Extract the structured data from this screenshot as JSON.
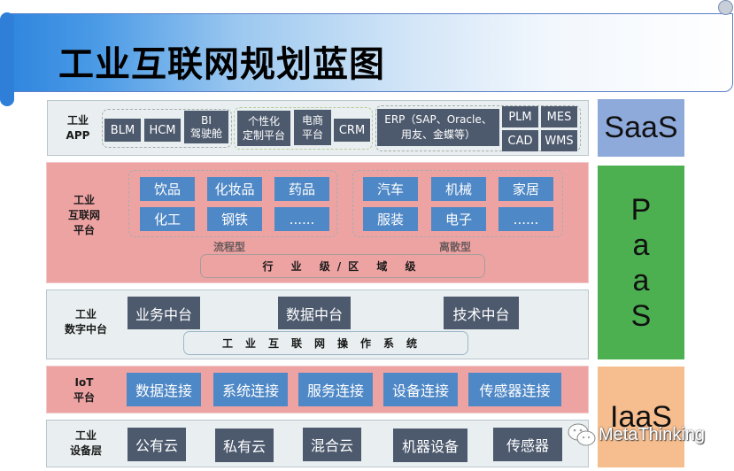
{
  "title": "工业互联网规划蓝图",
  "layers": {
    "app": {
      "label_line1": "工业",
      "label_line2": "APP",
      "group1": [
        "BLM",
        "HCM"
      ],
      "bi_line1": "BI",
      "bi_line2": "驾驶舱",
      "custom_line1": "个性化",
      "custom_line2": "定制平台",
      "ecom_line1": "电商",
      "ecom_line2": "平台",
      "crm": "CRM",
      "erp_line1": "ERP（SAP、Oracle、",
      "erp_line2": "用友、金蝶等）",
      "small_grid": [
        "PLM",
        "MES",
        "CAD",
        "WMS"
      ]
    },
    "platform": {
      "label_line1": "工业",
      "label_line2": "互联网",
      "label_line3": "平台",
      "process_items": [
        "饮品",
        "化妆品",
        "药品",
        "化工",
        "钢铁",
        "......"
      ],
      "process_caption": "流程型",
      "discrete_items": [
        "汽车",
        "机械",
        "家居",
        "服装",
        "电子",
        "......"
      ],
      "discrete_caption": "离散型",
      "level_bar": "行 业 级/区 域 级"
    },
    "digital": {
      "label_line1": "工业",
      "label_line2": "数字中台",
      "items": [
        "业务中台",
        "数据中台",
        "技术中台"
      ],
      "os_bar": "工业互联网操作系统"
    },
    "iot": {
      "label_line1": "IoT",
      "label_line2": "平台",
      "items": [
        "数据连接",
        "系统连接",
        "服务连接",
        "设备连接",
        "传感器连接"
      ]
    },
    "device": {
      "label_line1": "工业",
      "label_line2": "设备层",
      "items": [
        "公有云",
        "私有云",
        "混合云",
        "机器设备",
        "传感器"
      ]
    }
  },
  "tiers": {
    "saas": "SaaS",
    "paas": [
      "P",
      "a",
      "a",
      "S"
    ],
    "iaas": "IaaS"
  },
  "colors": {
    "saas": "#8eaadb",
    "paas": "#4caf50",
    "iaas": "#f6bd8f",
    "pink_band": "#eea3a3",
    "grey_band": "#e9eff0",
    "dark_box": "#4d5a6e",
    "blue_box": "#4f88c6"
  },
  "watermark": "MetaThinking"
}
